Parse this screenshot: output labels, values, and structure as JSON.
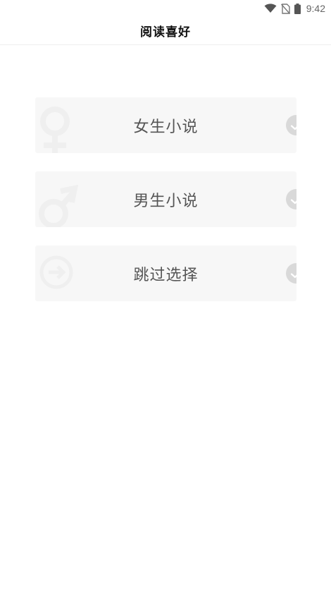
{
  "status_bar": {
    "time": "9:42",
    "icons": [
      "wifi-icon",
      "no-sim-icon",
      "battery-icon"
    ]
  },
  "header": {
    "title": "阅读喜好"
  },
  "options": [
    {
      "label": "女生小说",
      "icon": "female-symbol-icon",
      "checked": false
    },
    {
      "label": "男生小说",
      "icon": "male-symbol-icon",
      "checked": false
    },
    {
      "label": "跳过选择",
      "icon": "skip-arrow-icon",
      "checked": false
    }
  ],
  "colors": {
    "option_bg": "#f7f7f7",
    "label_text": "#555555",
    "check_bg": "#d9d9d9",
    "header_title": "#111111"
  }
}
